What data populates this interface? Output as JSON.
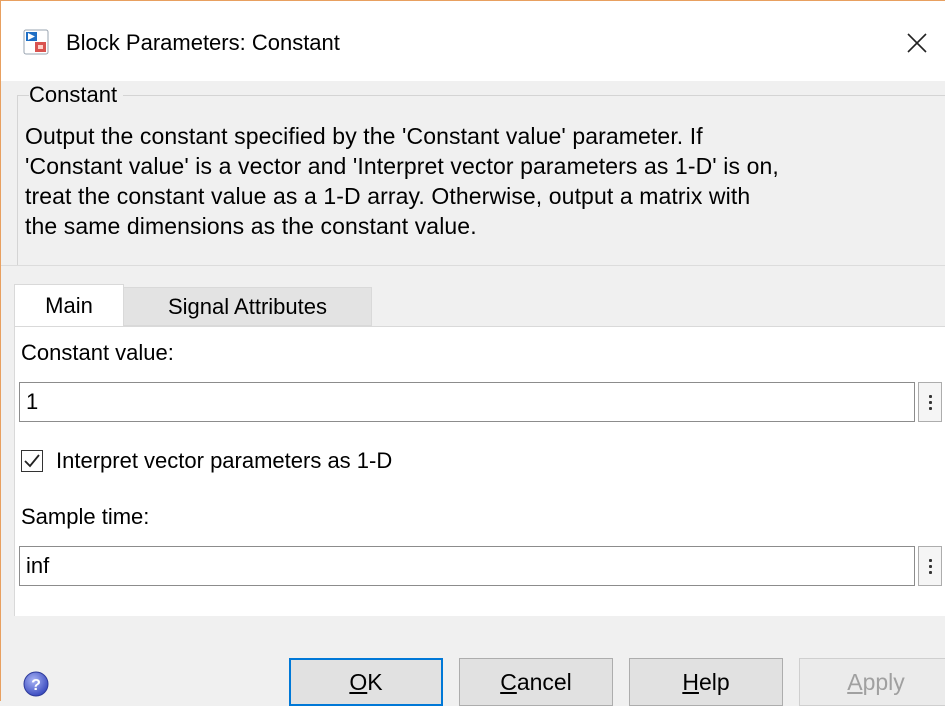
{
  "window": {
    "title": "Block Parameters: Constant",
    "close_icon": "close-icon",
    "app_icon": "simulink-block-icon"
  },
  "group": {
    "title": "Constant",
    "description_lines": [
      "Output the constant specified by the 'Constant value' parameter. If",
      "'Constant value' is a vector and 'Interpret vector parameters as 1-D' is on,",
      "treat the constant value as a 1-D array. Otherwise, output a matrix with",
      "the same dimensions as the constant value."
    ]
  },
  "tabs": [
    {
      "label": "Main",
      "selected": true
    },
    {
      "label": "Signal Attributes",
      "selected": false
    }
  ],
  "main": {
    "constant_value_label": "Constant value:",
    "constant_value": "1",
    "interpret_checkbox_label": "Interpret vector parameters as 1-D",
    "interpret_checked": true,
    "sample_time_label": "Sample time:",
    "sample_time": "inf"
  },
  "buttons": {
    "ok": {
      "prefix": "",
      "accel": "O",
      "suffix": "K"
    },
    "cancel": {
      "prefix": "",
      "accel": "C",
      "suffix": "ancel"
    },
    "help": {
      "prefix": "",
      "accel": "H",
      "suffix": "elp"
    },
    "apply": {
      "prefix": "",
      "accel": "A",
      "suffix": "pply",
      "enabled": false
    }
  },
  "colors": {
    "accent": "#0078d7",
    "window_border": "#e8a060",
    "background": "#f0f0f0"
  }
}
